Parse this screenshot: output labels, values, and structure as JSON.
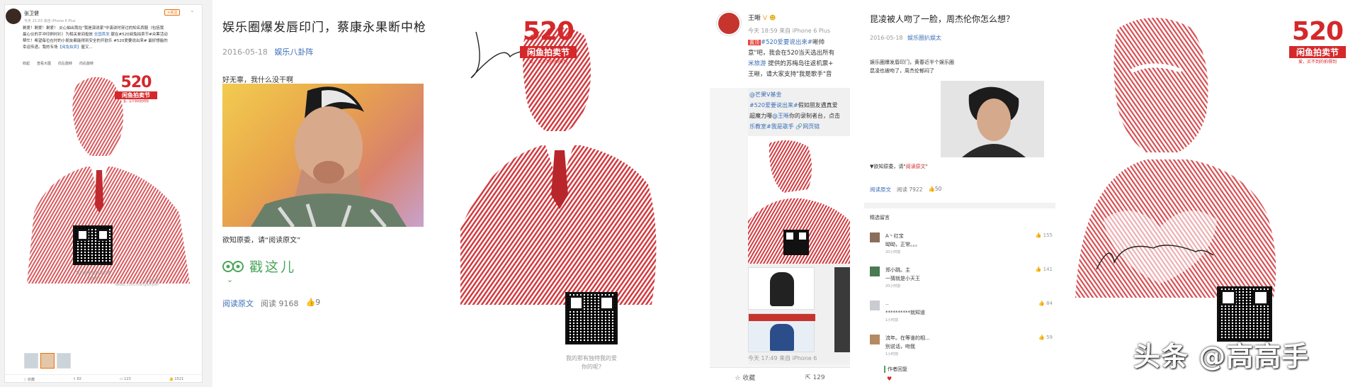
{
  "panel1": {
    "user_name": "张卫健",
    "time": "今天 21:03 来自 iPhone 6 Plus",
    "follow": "+关注",
    "text_a": "剩爱！剩爱！剩爱！ 炎心抽出我在\"我是演说家\"中演讲时穿过的知名西服（包括我",
    "text_b": "最心仪的手冲印刷衬衫）为相关单间投放 ",
    "text_b_link": "全国首发",
    "text_c": " 献在#520阅兔拍卖节#众筹活动",
    "text_d": "帮忙！希望每位在时的小朋友都能得到安全的开欧乐 #520爱要说出来# 最好想能的",
    "text_e": "幸运传递。我的专场",
    "text_e_link": "【阅兔拍卖】",
    "text_e2": "屋又...",
    "tools": [
      "收起",
      "查看大图",
      "向左旋转",
      "向右旋转"
    ],
    "logo_num": "520",
    "logo_sub": "闲鱼拍卖节",
    "logo_tiny": "爱，买不到的拍得到",
    "poster_foot_1": "我的那有独特我的爱",
    "poster_foot_2": "你的呢?",
    "weibo_mark": "@张卫健",
    "weibo_url": "weibo.com/zhangweijian",
    "actions": [
      "收藏",
      "82",
      "123",
      "1521"
    ]
  },
  "panel2": {
    "title": "娱乐圈爆发唇印门，蔡康永果断中枪",
    "date": "2016-05-18",
    "source": "娱乐八卦阵",
    "line1": "好无辜，我什么没干啊",
    "line2": "欲知原委，请“阅读原文”",
    "ta_text": "戳这儿",
    "read_link": "阅读原文",
    "read_count": "阅读 9168",
    "like_count": "9"
  },
  "panel3": {
    "logo_num": "520",
    "logo_sub": "闲鱼拍卖节",
    "logo_tiny": "爱，买不到的拍得到",
    "foot_1": "我的那有独特我的爱",
    "foot_2": "你的呢?"
  },
  "panel4": {
    "name": "王晰",
    "time": "今天 18:59 来自 iPhone 6 Plus",
    "pin": "置顶",
    "text_a_link": "#520爱要说出来#",
    "text_a": "晰帅",
    "text_b": "意\"吧，我会在520当天选出所有",
    "text_c_link": "米旅游",
    "text_c": " 提供的苏梅岛往返机票+",
    "text_d": "王晰，请大家支持\"我是歌手\"音",
    "rp_name": "@芒果V基金",
    "rp_a_link": "#520爱要说出来#",
    "rp_a": "假如朋友遇真爱",
    "rp_b": "超魔力曝",
    "rp_b_link": "@王晰",
    "rp_b2": "你的录制者台，点击",
    "rp_c_link": "乐教室#我是歌手",
    "rp_c2": "网页链",
    "time2": "今天 17:49 来自 iPhone 6",
    "actions": [
      "收藏",
      "129"
    ]
  },
  "panel5": {
    "title": "昆凌被人吻了一脸，周杰伦你怎么想？",
    "date": "2016-05-18",
    "source": "娱乐圈扒娱太",
    "body_1": "娱乐圈爆发唇印门，黄春近半个娱乐圈",
    "body_2": "昆凌也被吻了，周杰伦郁闷了",
    "read_prefix": "▼欲知原委，请\"",
    "read_red": "阅读原文",
    "read_suffix": "\"",
    "foot_link": "阅读原文",
    "foot_count": "阅读 7922",
    "foot_likes": "50",
    "section": "精选留言",
    "comments": [
      {
        "name": "A丶红宝",
        "text": "呦呦，正常。。。",
        "time": "20小时前",
        "likes": "155"
      },
      {
        "name": "郑小跳。主",
        "text": "一猜就是小天王",
        "time": "20小时前",
        "likes": "141"
      },
      {
        "name": "..",
        "text": "**********就知道",
        "time": "1小时前",
        "likes": "84"
      },
      {
        "name": "流年。在等谁的相...",
        "text": "别说话，吻我",
        "time": "1小时前",
        "likes": "59"
      }
    ],
    "author_reply": "作者回复"
  },
  "panel6": {
    "logo_num": "520",
    "logo_sub": "闲鱼拍卖节",
    "logo_tiny": "爱，买不到的拍得到"
  },
  "watermark": "头条 @高高手",
  "colors": {
    "brand_red": "#d4282b",
    "link_blue": "#3b6eb6",
    "tripadvisor_green": "#4aa55a"
  }
}
